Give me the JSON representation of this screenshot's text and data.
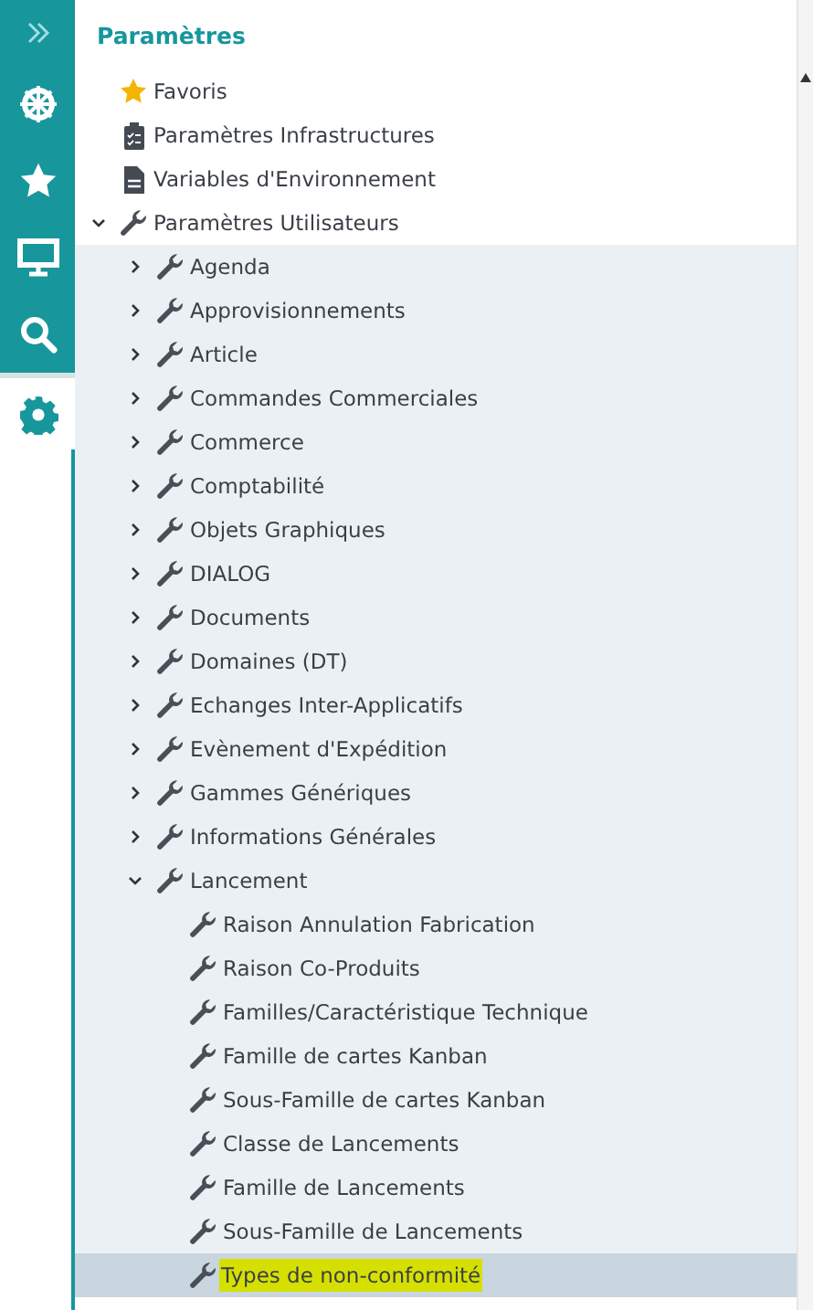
{
  "rail": {
    "items": [
      {
        "kind": "expand",
        "selected": false
      },
      {
        "kind": "wheel",
        "selected": false
      },
      {
        "kind": "star",
        "selected": false
      },
      {
        "kind": "monitor",
        "selected": false
      },
      {
        "kind": "search",
        "selected": false
      },
      {
        "kind": "settings",
        "selected": true
      }
    ]
  },
  "panel": {
    "title": "Paramètres",
    "tree": [
      {
        "label": "Favoris",
        "kind": "star"
      },
      {
        "label": "Paramètres Infrastructures",
        "kind": "clipboard"
      },
      {
        "label": "Variables d'Environnement",
        "kind": "document"
      },
      {
        "label": "Paramètres Utilisateurs",
        "kind": "wrench",
        "expanded": true,
        "children": [
          {
            "label": "Agenda",
            "kind": "wrench",
            "expanded": false
          },
          {
            "label": "Approvisionnements",
            "kind": "wrench",
            "expanded": false
          },
          {
            "label": "Article",
            "kind": "wrench",
            "expanded": false
          },
          {
            "label": "Commandes Commerciales",
            "kind": "wrench",
            "expanded": false
          },
          {
            "label": "Commerce",
            "kind": "wrench",
            "expanded": false
          },
          {
            "label": "Comptabilité",
            "kind": "wrench",
            "expanded": false
          },
          {
            "label": "Objets Graphiques",
            "kind": "wrench",
            "expanded": false
          },
          {
            "label": "DIALOG",
            "kind": "wrench",
            "expanded": false
          },
          {
            "label": "Documents",
            "kind": "wrench",
            "expanded": false
          },
          {
            "label": "Domaines (DT)",
            "kind": "wrench",
            "expanded": false
          },
          {
            "label": "Echanges Inter-Applicatifs",
            "kind": "wrench",
            "expanded": false
          },
          {
            "label": "Evènement d'Expédition",
            "kind": "wrench",
            "expanded": false
          },
          {
            "label": "Gammes Génériques",
            "kind": "wrench",
            "expanded": false
          },
          {
            "label": "Informations Générales",
            "kind": "wrench",
            "expanded": false
          },
          {
            "label": "Lancement",
            "kind": "wrench",
            "expanded": true,
            "children": [
              {
                "label": "Raison Annulation Fabrication",
                "kind": "wrench",
                "selected": false,
                "highlighted": false
              },
              {
                "label": "Raison Co-Produits",
                "kind": "wrench",
                "selected": false,
                "highlighted": false
              },
              {
                "label": "Familles/Caractéristique Technique",
                "kind": "wrench",
                "selected": false,
                "highlighted": false
              },
              {
                "label": "Famille de cartes Kanban",
                "kind": "wrench",
                "selected": false,
                "highlighted": false
              },
              {
                "label": "Sous-Famille de cartes Kanban",
                "kind": "wrench",
                "selected": false,
                "highlighted": false
              },
              {
                "label": "Classe de Lancements",
                "kind": "wrench",
                "selected": false,
                "highlighted": false
              },
              {
                "label": "Famille de Lancements",
                "kind": "wrench",
                "selected": false,
                "highlighted": false
              },
              {
                "label": "Sous-Famille de Lancements",
                "kind": "wrench",
                "selected": false,
                "highlighted": false
              },
              {
                "label": "Types de non-conformité",
                "kind": "wrench",
                "selected": true,
                "highlighted": true
              }
            ]
          }
        ]
      }
    ]
  }
}
